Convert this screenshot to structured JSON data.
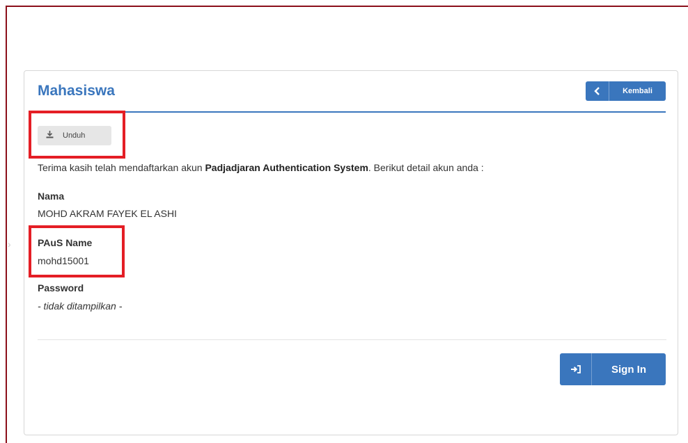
{
  "panel": {
    "title": "Mahasiswa",
    "back_label": "Kembali",
    "download_label": "Unduh"
  },
  "intro": {
    "before": "Terima kasih telah mendaftarkan akun ",
    "bold": "Padjadjaran Authentication System",
    "after": ". Berikut detail akun anda :"
  },
  "fields": {
    "nama_label": "Nama",
    "nama_value": "MOHD AKRAM FAYEK EL ASHI",
    "paus_label": "PAuS Name",
    "paus_value": "mohd15001",
    "password_label": "Password",
    "password_value": "- tidak ditampilkan -"
  },
  "actions": {
    "signin_label": "Sign In"
  },
  "colors": {
    "accent": "#3a76bd",
    "highlight": "#e41e25",
    "frame": "#8b0f1a"
  },
  "icons": {
    "back": "chevron-left-icon",
    "download": "download-icon",
    "signin": "sign-in-icon",
    "side": "chevron-right-icon"
  }
}
